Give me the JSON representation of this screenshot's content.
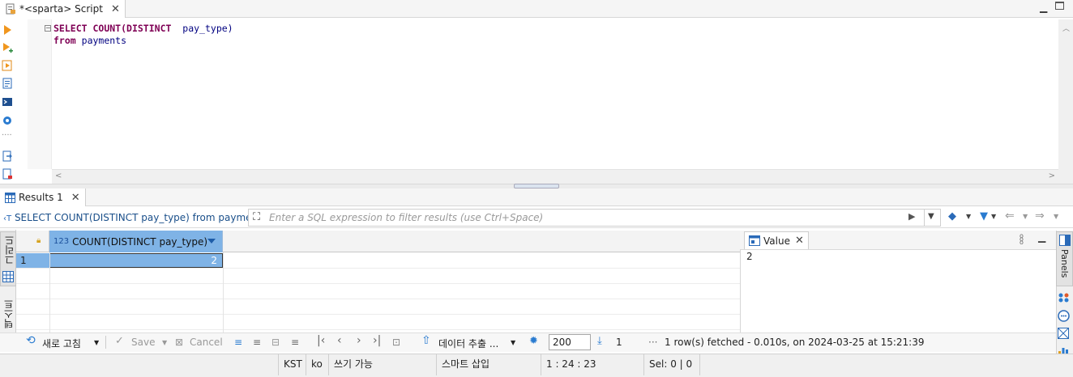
{
  "editor": {
    "tab_title": "*<sparta> Script",
    "line1_keyword_select": "SELECT",
    "line1_func": "COUNT(DISTINCT",
    "line1_column": "pay_type)",
    "line2_keyword_from": "from",
    "line2_table": "payments"
  },
  "results": {
    "tab_title": "Results 1",
    "query_label": "SELECT COUNT(DISTINCT pay_type) from payments",
    "filter_placeholder": "Enter a SQL expression to filter results (use Ctrl+Space)",
    "left_tabs": [
      "그리드",
      "텍스트"
    ],
    "column_type": "123",
    "column_name": "COUNT(DISTINCT  pay_type)",
    "rows": [
      {
        "num": "1",
        "value": "2"
      }
    ]
  },
  "value_panel": {
    "tab_title": "Value",
    "value": "2"
  },
  "right_panel": {
    "tab_title": "Panels"
  },
  "toolbar": {
    "refresh_label": "새로 고침",
    "save_label": "Save",
    "cancel_label": "Cancel",
    "export_label": "데이터 추출 ...",
    "limit_value": "200",
    "row_count": "1",
    "more": "···",
    "fetch_status": "1 row(s) fetched - 0.010s, on 2024-03-25 at 15:21:39"
  },
  "statusbar": {
    "timezone": "KST",
    "locale": "ko",
    "write_mode": "쓰기 가능",
    "insert_mode": "스마트 삽입",
    "position": "1 : 24 : 23",
    "selection": "Sel: 0 | 0"
  },
  "colors": {
    "accent": "#7fb3e6",
    "keyword": "#7f0055",
    "table": "#000080",
    "query_label": "#1a4f8a"
  }
}
